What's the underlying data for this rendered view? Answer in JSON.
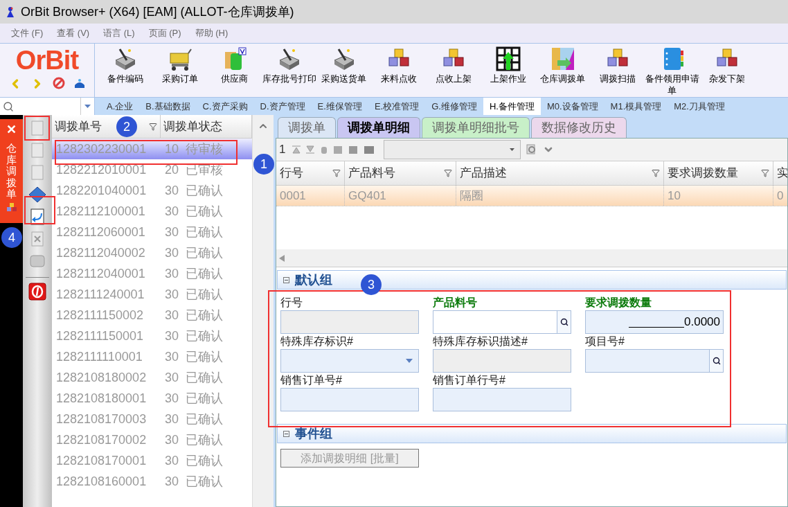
{
  "window": {
    "title": "OrBit Browser+ (X64) [EAM] (ALLOT-仓库调拨单)"
  },
  "menu": [
    "文件 (F)",
    "查看 (V)",
    "语言 (L)",
    "页面 (P)",
    "帮助 (H)"
  ],
  "logo": {
    "text": "OrBit"
  },
  "toolbar": [
    {
      "label": "备件编码",
      "kind": "wand"
    },
    {
      "label": "采购订单",
      "kind": "cart"
    },
    {
      "label": "供应商",
      "kind": "supplier"
    },
    {
      "label": "库存批号打印",
      "kind": "wand"
    },
    {
      "label": "采购送货单",
      "kind": "wand"
    },
    {
      "label": "来料点收",
      "kind": "cubes"
    },
    {
      "label": "点收上架",
      "kind": "cubes"
    },
    {
      "label": "上架作业",
      "kind": "grid"
    },
    {
      "label": "仓库调拨单",
      "kind": "transfer"
    },
    {
      "label": "调拨扫描",
      "kind": "cubes"
    },
    {
      "label": "备件领用申请单",
      "kind": "book"
    },
    {
      "label": "杂发下架",
      "kind": "cubes"
    }
  ],
  "module_tabs": [
    {
      "label": "A.企业",
      "selected": false
    },
    {
      "label": "B.基础数据",
      "selected": false
    },
    {
      "label": "C.资产采购",
      "selected": false
    },
    {
      "label": "D.资产管理",
      "selected": false
    },
    {
      "label": "E.维保管理",
      "selected": false
    },
    {
      "label": "E.校准管理",
      "selected": false
    },
    {
      "label": "G.维修管理",
      "selected": false
    },
    {
      "label": "H.备件管理",
      "selected": true
    },
    {
      "label": "M0.设备管理",
      "selected": false
    },
    {
      "label": "M1.模具管理",
      "selected": false
    },
    {
      "label": "M2.刀具管理",
      "selected": false
    }
  ],
  "side_tab": {
    "label": "仓库调拨单",
    "close": "✕"
  },
  "list": {
    "columns": [
      "调拨单号",
      "调拨单状态"
    ],
    "rows": [
      {
        "number": "1282302230001",
        "status": "10  待审核",
        "selected": true
      },
      {
        "number": "1282212010001",
        "status": "20  已审核",
        "selected": false
      },
      {
        "number": "1282201040001",
        "status": "30  已确认",
        "selected": false
      },
      {
        "number": "1282112100001",
        "status": "30  已确认",
        "selected": false
      },
      {
        "number": "1282112060001",
        "status": "30  已确认",
        "selected": false
      },
      {
        "number": "1282112040002",
        "status": "30  已确认",
        "selected": false
      },
      {
        "number": "1282112040001",
        "status": "30  已确认",
        "selected": false
      },
      {
        "number": "1282111240001",
        "status": "30  已确认",
        "selected": false
      },
      {
        "number": "1282111150002",
        "status": "30  已确认",
        "selected": false
      },
      {
        "number": "1282111150001",
        "status": "30  已确认",
        "selected": false
      },
      {
        "number": "1282111110001",
        "status": "30  已确认",
        "selected": false
      },
      {
        "number": "1282108180002",
        "status": "30  已确认",
        "selected": false
      },
      {
        "number": "1282108180001",
        "status": "30  已确认",
        "selected": false
      },
      {
        "number": "1282108170003",
        "status": "30  已确认",
        "selected": false
      },
      {
        "number": "1282108170002",
        "status": "30  已确认",
        "selected": false
      },
      {
        "number": "1282108170001",
        "status": "30  已确认",
        "selected": false
      },
      {
        "number": "1282108160001",
        "status": "30  已确认",
        "selected": false
      }
    ]
  },
  "detail_tabs": [
    {
      "label": "调拨单",
      "selected": false,
      "color": "#dbe6f5"
    },
    {
      "label": "调拨单明细",
      "selected": true,
      "color": "#c9c6f2"
    },
    {
      "label": "调拨单明细批号",
      "selected": false,
      "color": "#c8f0c8"
    },
    {
      "label": "数据修改历史",
      "selected": false,
      "color": "#ecd8ec"
    }
  ],
  "record_count": "1",
  "grid": {
    "columns": [
      "行号",
      "产品料号",
      "产品描述",
      "要求调拨数量",
      "实"
    ],
    "rows": [
      [
        "0001",
        "GQ401",
        "隔圈",
        "10",
        "0"
      ]
    ]
  },
  "groups": [
    {
      "title": "默认组",
      "fields": [
        {
          "label": "行号",
          "kind": "readonly",
          "required": false
        },
        {
          "label": "产品料号",
          "kind": "lookup",
          "required": true
        },
        {
          "label": "要求调拨数量",
          "kind": "number",
          "required": true,
          "value": "0.0000"
        },
        {
          "label": "特殊库存标识#",
          "kind": "dropdown",
          "required": false
        },
        {
          "label": "特殊库存标识描述#",
          "kind": "readonly",
          "required": false
        },
        {
          "label": "项目号#",
          "kind": "lookup",
          "required": false
        },
        {
          "label": "销售订单号#",
          "kind": "text",
          "required": false
        },
        {
          "label": "销售订单行号#",
          "kind": "text",
          "required": false
        }
      ]
    },
    {
      "title": "事件组",
      "buttons": [
        "添加调拨明细 [批量]"
      ]
    }
  ],
  "annotations": [
    "1",
    "2",
    "3",
    "4"
  ]
}
